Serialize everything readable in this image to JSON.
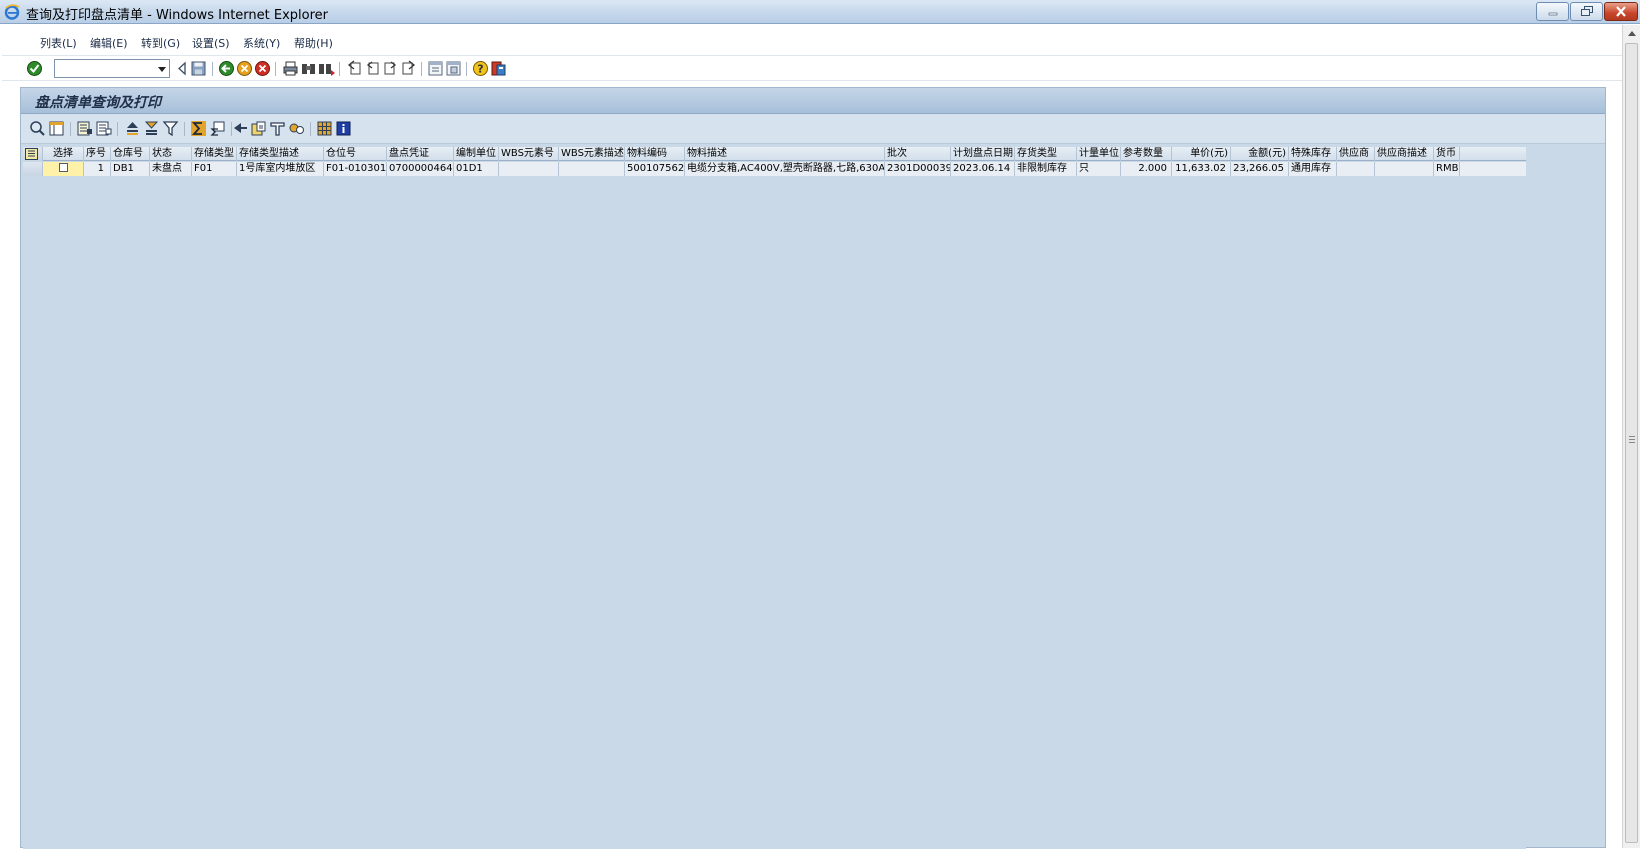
{
  "window": {
    "title": "查询及打印盘点清单 - Windows Internet Explorer"
  },
  "menu": [
    {
      "label": "列表(L)"
    },
    {
      "label": "编辑(E)"
    },
    {
      "label": "转到(G)"
    },
    {
      "label": "设置(S)"
    },
    {
      "label": "系统(Y)"
    },
    {
      "label": "帮助(H)"
    }
  ],
  "command_field": {
    "value": ""
  },
  "app": {
    "title": "盘点清单查询及打印"
  },
  "grid": {
    "columns": [
      "选择",
      "序号",
      "仓库号",
      "状态",
      "存储类型",
      "存储类型描述",
      "仓位号",
      "盘点凭证",
      "编制单位",
      "WBS元素号",
      "WBS元素描述",
      "物料编码",
      "物料描述",
      "批次",
      "计划盘点日期",
      "存货类型",
      "计量单位",
      "参考数量",
      "单价(元)",
      "金额(元)",
      "特殊库存",
      "供应商",
      "供应商描述",
      "货币"
    ],
    "rows": [
      {
        "selected": false,
        "cells": [
          "1",
          "DB1",
          "未盘点",
          "F01",
          "1号库室内堆放区",
          "F01-010301",
          "0700000464",
          "01D1",
          "",
          "",
          "500107562",
          "电缆分支箱,AC400V,塑壳断路器,七路,630A",
          "2301D00039",
          "2023.06.14",
          "非限制库存",
          "只",
          "2.000",
          "11,633.02",
          "23,266.05",
          "通用库存",
          "",
          "",
          "RMB"
        ]
      }
    ]
  },
  "icons": {
    "system_toolbar": [
      "enter-icon",
      "back-icon",
      "save-icon",
      "green-back-icon",
      "exit-icon",
      "cancel-icon",
      "print-icon",
      "find-icon",
      "find-next-icon",
      "first-page-icon",
      "previous-page-icon",
      "next-page-icon",
      "last-page-icon",
      "create-session-icon",
      "shortcut-icon",
      "help-icon",
      "customize-layout-icon"
    ],
    "app_toolbar": [
      "details-icon",
      "select-layout-icon",
      "select-all-icon",
      "deselect-all-icon",
      "sort-ascending-icon",
      "sort-descending-icon",
      "filter-icon",
      "sum-icon",
      "subtotal-icon",
      "print-preview-icon",
      "export-icon",
      "mail-icon",
      "abc-analysis-icon",
      "change-layout-icon",
      "information-icon"
    ]
  }
}
